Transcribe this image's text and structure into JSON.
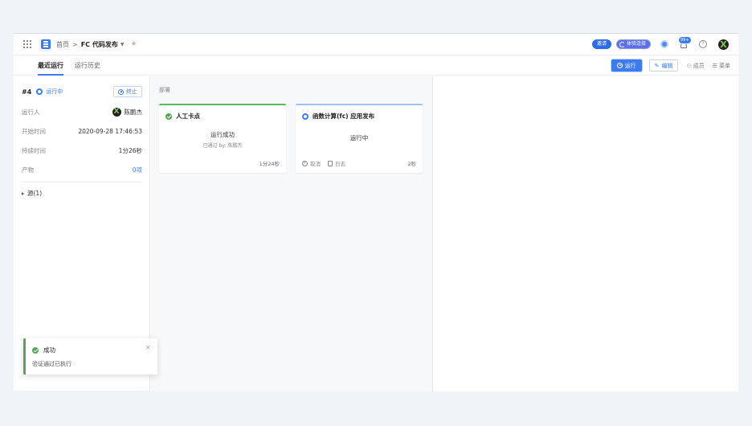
{
  "header": {
    "breadcrumb_home": "首页",
    "breadcrumb_sep": ">",
    "pipeline_name": "FC 代码发布",
    "invite_label": "邀请",
    "experience_label": "体验连接",
    "notification_badge": "99+"
  },
  "tabs": [
    {
      "label": "最近运行"
    },
    {
      "label": "运行历史"
    }
  ],
  "actions": {
    "run_label": "运行",
    "edit_label": "编辑",
    "members_label": "成员",
    "menu_label": "菜单"
  },
  "run": {
    "number": "#4",
    "status": "运行中",
    "stop_label": "终止",
    "runner_label": "运行人",
    "runner_name": "陈鹏杰",
    "start_label": "开始时间",
    "start_value": "2020-09-28 17:46:53",
    "duration_label": "持续时间",
    "duration_value": "1分26秒",
    "artifact_label": "产物",
    "artifact_value": "0项",
    "source_label": "源(1)"
  },
  "stage": {
    "title": "部署",
    "cards": [
      {
        "title": "人工卡点",
        "result": "运行成功",
        "sub": "已通过 by: 陈鹏杰",
        "time": "1分24秒"
      },
      {
        "title": "函数计算(fc) 应用发布",
        "result": "运行中",
        "cancel_label": "取消",
        "log_label": "日志",
        "time": "2秒"
      }
    ]
  },
  "toast": {
    "title": "成功",
    "message": "验证通过已执行",
    "close": "×"
  },
  "colors": {
    "accent": "#3b7cf5",
    "success": "#52a852"
  }
}
